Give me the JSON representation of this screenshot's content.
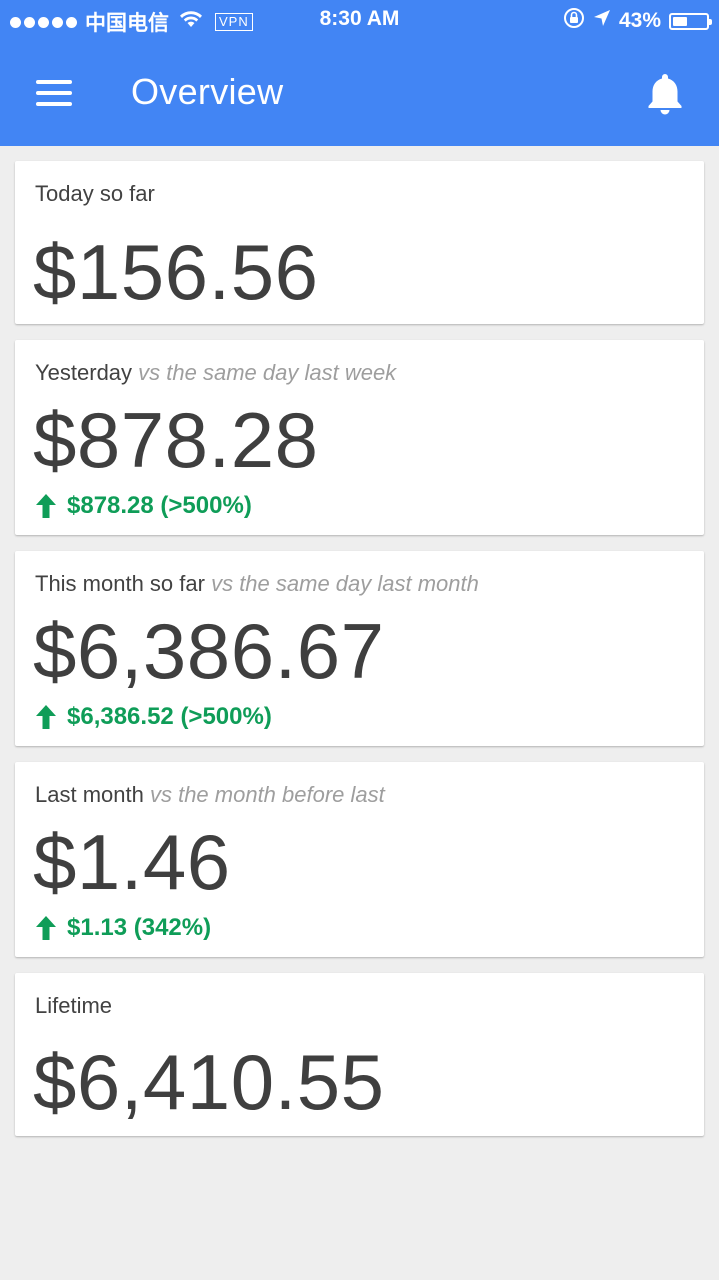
{
  "status_bar": {
    "carrier": "中国电信",
    "vpn": "VPN",
    "time": "8:30 AM",
    "battery": "43%",
    "battery_level": 0.43
  },
  "app_bar": {
    "title": "Overview",
    "color": "#4285f4",
    "menu_icon": "hamburger-menu-icon",
    "notification_icon": "bell-icon"
  },
  "cards": [
    {
      "label": "Today so far",
      "sublabel": "",
      "amount": "$156.56",
      "change": ""
    },
    {
      "label": "Yesterday",
      "sublabel": "vs the same day last week",
      "amount": "$878.28",
      "change": "$878.28 (>500%)"
    },
    {
      "label": "This month so far",
      "sublabel": "vs the same day last month",
      "amount": "$6,386.67",
      "change": "$6,386.52 (>500%)"
    },
    {
      "label": "Last month",
      "sublabel": "vs the month before last",
      "amount": "$1.46",
      "change": "$1.13 (342%)"
    },
    {
      "label": "Lifetime",
      "sublabel": "",
      "amount": "$6,410.55",
      "change": ""
    }
  ],
  "colors": {
    "positive": "#0f9d58",
    "background": "#eeeeee"
  }
}
